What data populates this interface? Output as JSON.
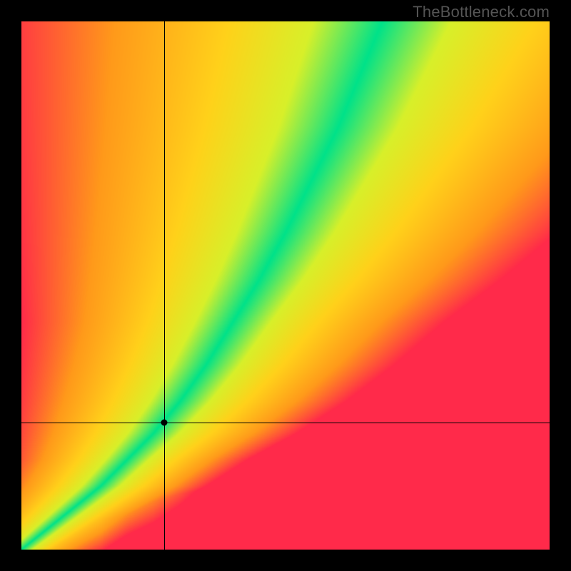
{
  "watermark": "TheBottleneck.com",
  "chart_data": {
    "type": "heatmap",
    "title": "",
    "xlabel": "",
    "ylabel": "",
    "xlim": [
      0,
      1
    ],
    "ylim": [
      0,
      1
    ],
    "grid": false,
    "legend": false,
    "marker": {
      "x": 0.27,
      "y": 0.24
    },
    "crosshair": {
      "x": 0.27,
      "y": 0.24
    },
    "optimal_curve": {
      "description": "green ridge y as function of x (approx read from image)",
      "x": [
        0.0,
        0.05,
        0.1,
        0.15,
        0.2,
        0.25,
        0.3,
        0.35,
        0.4,
        0.45,
        0.5,
        0.55,
        0.6,
        0.65,
        0.7,
        0.75,
        0.8,
        0.85,
        0.9,
        0.95,
        1.0
      ],
      "y": [
        0.0,
        0.04,
        0.08,
        0.12,
        0.17,
        0.22,
        0.28,
        0.35,
        0.43,
        0.51,
        0.6,
        0.7,
        0.8,
        0.92,
        1.04,
        1.17,
        1.31,
        1.45,
        1.6,
        1.76,
        1.93
      ]
    },
    "ridge_width": {
      "description": "approximate half-width of green band in y-units as function of x",
      "x": [
        0.0,
        0.2,
        0.4,
        0.6,
        0.8,
        1.0
      ],
      "w": [
        0.01,
        0.02,
        0.035,
        0.055,
        0.075,
        0.095
      ]
    },
    "colors": {
      "best": "#00E28A",
      "good": "#D8F02A",
      "mid": "#FFD21A",
      "warm": "#FF9A1A",
      "bad": "#FF2A4A"
    }
  }
}
